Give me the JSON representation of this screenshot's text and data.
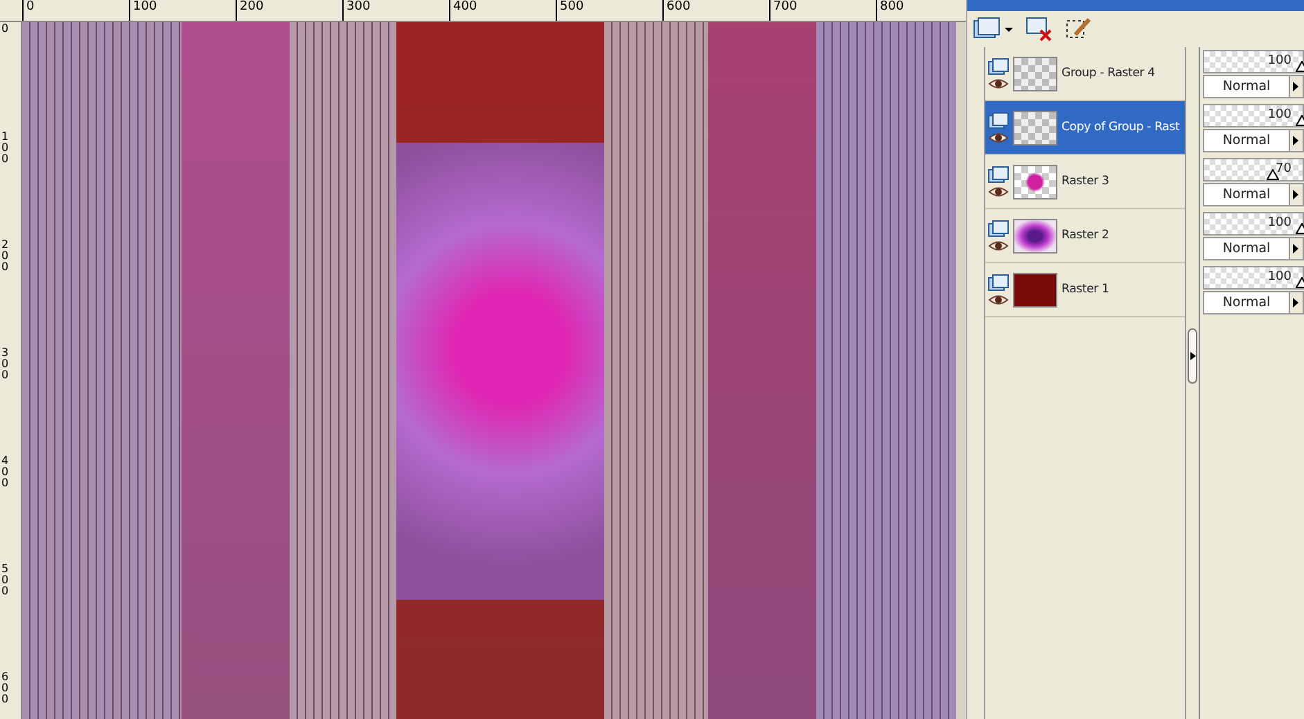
{
  "rulers": {
    "horizontal": [
      "0",
      "100",
      "200",
      "300",
      "400",
      "500",
      "600",
      "700",
      "800"
    ],
    "vertical": [
      "0",
      "100",
      "200",
      "300",
      "400",
      "500",
      "600"
    ]
  },
  "layers": [
    {
      "name": "Group - Raster 4",
      "selected": false,
      "kind": "checker",
      "opacity": "100",
      "level": 1,
      "blend_mode": "Normal"
    },
    {
      "name": "Copy of Group - Rast",
      "selected": true,
      "kind": "checker",
      "opacity": "100",
      "level": 1,
      "blend_mode": "Normal"
    },
    {
      "name": "Raster 3",
      "selected": false,
      "kind": "flower",
      "opacity": "70",
      "level": 0.7,
      "blend_mode": "Normal"
    },
    {
      "name": "Raster 2",
      "selected": false,
      "kind": "glow",
      "opacity": "100",
      "level": 1,
      "blend_mode": "Normal"
    },
    {
      "name": "Raster 1",
      "selected": false,
      "kind": "solid",
      "opacity": "100",
      "level": 1,
      "blend_mode": "Normal"
    }
  ]
}
